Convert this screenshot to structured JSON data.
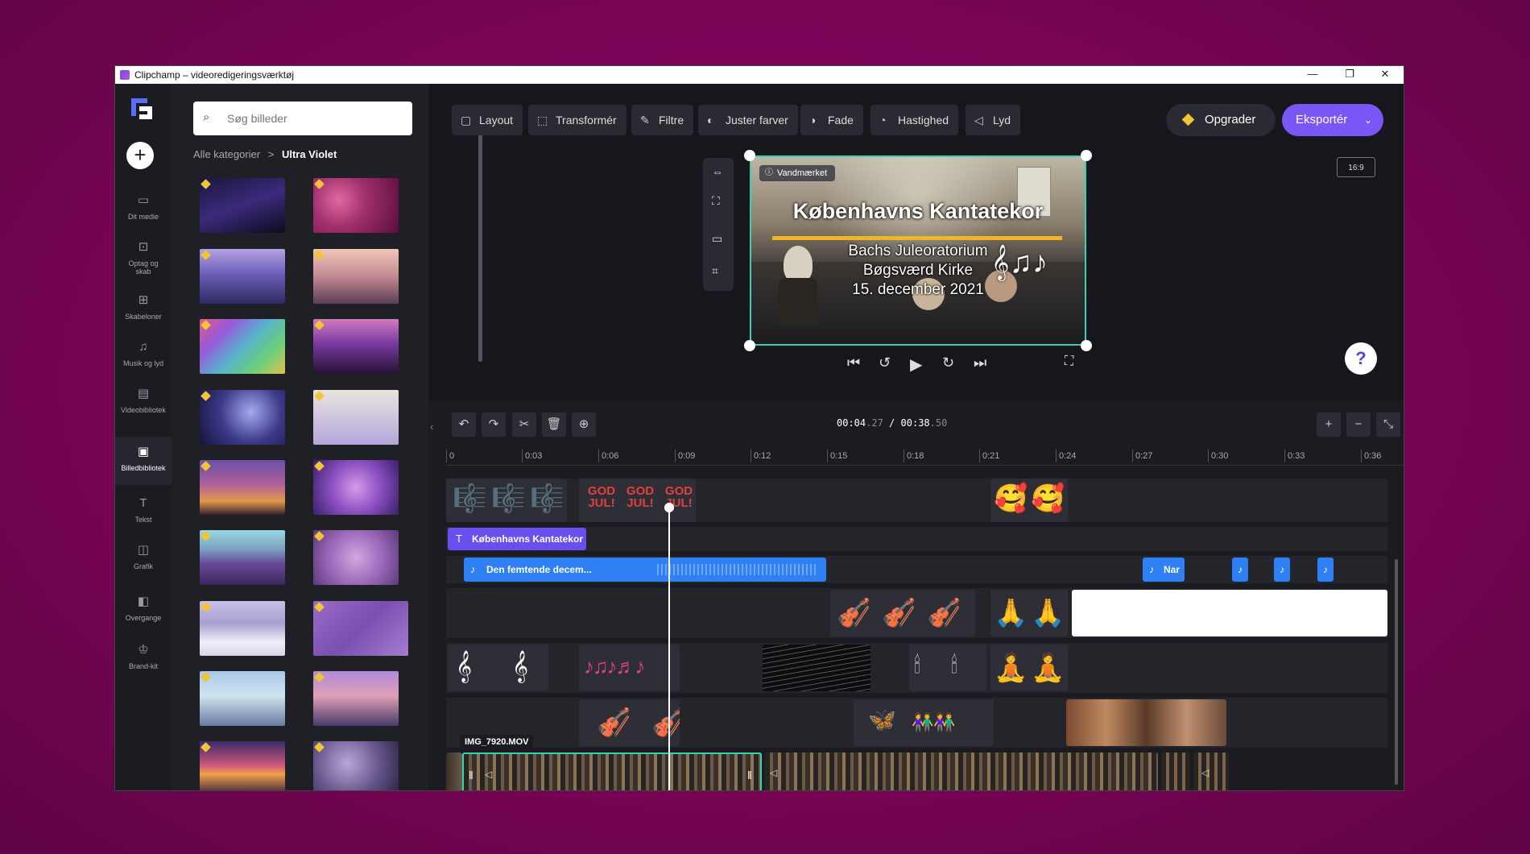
{
  "window": {
    "title": "Clipchamp – videoredigeringsværktøj",
    "controls": [
      "—",
      "❐",
      "✕"
    ]
  },
  "nav": {
    "add_label": "+",
    "items": [
      {
        "label": "Dit medie",
        "icon": "folder-icon"
      },
      {
        "label": "Optag og skab",
        "icon": "camera-icon"
      },
      {
        "label": "Skabeloner",
        "icon": "templates-icon"
      },
      {
        "label": "Musik og lyd",
        "icon": "music-icon"
      },
      {
        "label": "Videobibliotek",
        "icon": "video-library-icon"
      },
      {
        "label": "Billedbibliotek",
        "icon": "image-library-icon"
      },
      {
        "label": "Tekst",
        "icon": "text-icon"
      },
      {
        "label": "Grafik",
        "icon": "graphics-icon"
      },
      {
        "label": "Overgange",
        "icon": "transitions-icon"
      },
      {
        "label": "Brand-kit",
        "icon": "brand-kit-icon"
      }
    ]
  },
  "panel": {
    "search_placeholder": "Søg billeder",
    "breadcrumb_root": "Alle kategorier",
    "breadcrumb_sep": ">",
    "breadcrumb_current": "Ultra Violet"
  },
  "toolbar": {
    "layout": "Layout",
    "transform": "Transformér",
    "filters": "Filtre",
    "adjust_colors": "Juster farver",
    "fade": "Fade",
    "speed": "Hastighed",
    "audio": "Lyd",
    "upgrade": "Opgrader",
    "export": "Eksportér",
    "aspect_ratio": "16:9"
  },
  "preview": {
    "watermark": "Vandmærket",
    "title": "Københavns Kantatekor",
    "line1": "Bachs Juleoratorium",
    "line2": "Bøgsværd Kirke",
    "line3": "15. december 2021"
  },
  "timeline": {
    "current_time_main": "00:04",
    "current_time_frac": ".27",
    "separator": "/",
    "total_time_main": "00:38",
    "total_time_frac": ".50",
    "ruler": [
      "0",
      "0:03",
      "0:06",
      "0:09",
      "0:12",
      "0:15",
      "0:18",
      "0:21",
      "0:24",
      "0:27",
      "0:30",
      "0:33",
      "0:36"
    ],
    "text_clip": "Københavns Kantatekor",
    "audio_clip_1": "Den femtende decem...",
    "audio_clip_2": "Nar",
    "god_jul": "GOD JUL!",
    "video_clip": "IMG_7920.MOV"
  },
  "colors": {
    "accent": "#7a56f7",
    "selection": "#39d0b4",
    "text_track": "#6a4ff0",
    "audio_track": "#2f7ff5",
    "premium": "#f2c534"
  }
}
